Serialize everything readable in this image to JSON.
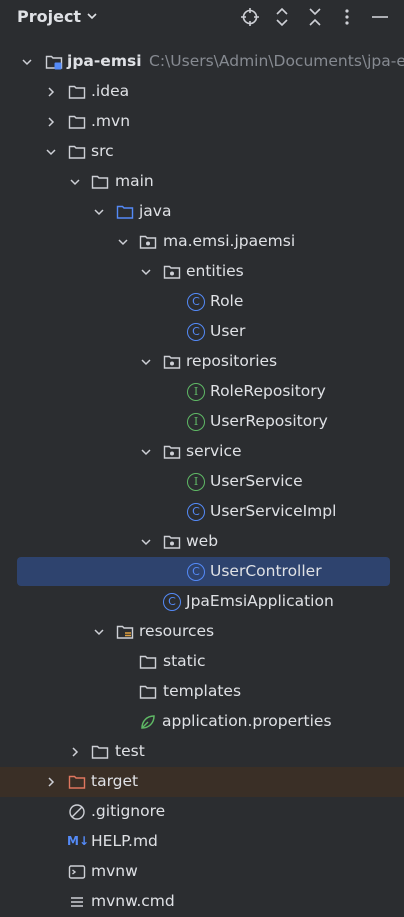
{
  "header": {
    "title": "Project"
  },
  "tree": {
    "root": {
      "name": "jpa-emsi",
      "path": "C:\\Users\\Admin\\Documents\\jpa-e"
    },
    "idea": ".idea",
    "mvn": ".mvn",
    "src": "src",
    "main": "main",
    "java": "java",
    "package": "ma.emsi.jpaemsi",
    "entities": "entities",
    "role": "Role",
    "user": "User",
    "repositories": "repositories",
    "role_repository": "RoleRepository",
    "user_repository": "UserRepository",
    "service": "service",
    "user_service": "UserService",
    "user_service_impl": "UserServiceImpl",
    "web": "web",
    "user_controller": "UserController",
    "app": "JpaEmsiApplication",
    "resources": "resources",
    "static": "static",
    "templates": "templates",
    "app_props": "application.properties",
    "test": "test",
    "target": "target",
    "gitignore": ".gitignore",
    "help": "HELP.md",
    "mvnw": "mvnw",
    "mvnw_cmd": "mvnw.cmd"
  },
  "badges": {
    "class": "C",
    "interface": "I",
    "markdown": "M↓"
  }
}
